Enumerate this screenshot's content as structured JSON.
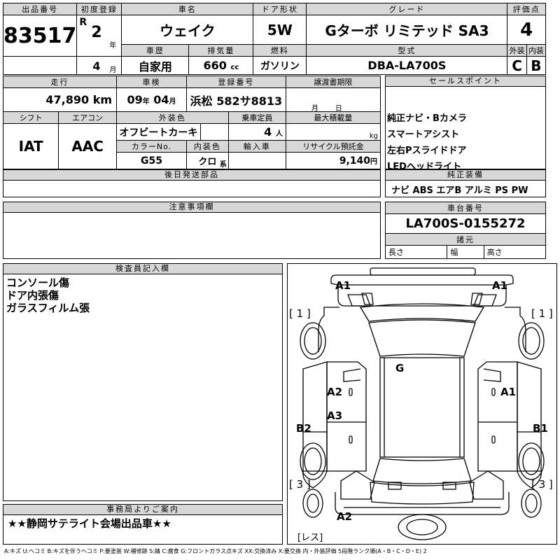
{
  "header": {
    "lot_label": "出品番号",
    "lot_no": "83517",
    "first_reg_label": "初度登録",
    "era": "R",
    "year": "2",
    "year_unit": "年",
    "month": "4",
    "month_unit": "月",
    "car_name_label": "車名",
    "car_name": "ウェイク",
    "door_label": "ドア形状",
    "door": "5W",
    "grade_label": "グレード",
    "grade": "Gターボ リミテッド SA3",
    "score_label": "評価点",
    "score": "4",
    "history_label": "車歴",
    "history": "自家用",
    "displacement_label": "排気量",
    "displacement": "660",
    "displacement_unit": "cc",
    "fuel_label": "燃料",
    "fuel": "ガソリン",
    "model_label": "型式",
    "model": "DBA-LA700S",
    "ext_label": "外装",
    "ext": "C",
    "int_label": "内装",
    "int": "B"
  },
  "row2": {
    "mileage_label": "走行",
    "mileage": "47,890",
    "mileage_unit": "km",
    "inspection_label": "車検",
    "insp_y": "09",
    "insp_y_unit": "年",
    "insp_m": "04",
    "insp_m_unit": "月",
    "plate_label": "登録番号",
    "plate": "浜松 582サ8813",
    "transfer_label": "譲渡書期限",
    "transfer_m_unit": "月",
    "transfer_d_unit": "日",
    "shift_label": "シフト",
    "shift": "IAT",
    "ac_label": "エアコン",
    "ac": "AAC",
    "color_label": "外装色",
    "color": "オフビートカーキ",
    "capacity_label": "乗車定員",
    "capacity": "4",
    "capacity_unit": "人",
    "load_label": "最大積載量",
    "load_unit": "kg",
    "color_no_label": "カラーNo.",
    "color_no": "G55",
    "interior_color_label": "内装色",
    "interior_color": "クロ",
    "interior_unit": "系",
    "import_label": "輸入車",
    "recycle_label": "リサイクル預託金",
    "recycle": "9,140",
    "recycle_unit": "円",
    "later_label": "後日発送部品"
  },
  "sales": {
    "label": "セールスポイント",
    "items": [
      "純正ナビ・Bカメラ",
      "スマートアシスト",
      "左右Pスライドドア",
      "LEDヘッドライト"
    ],
    "equip_label": "純正装備",
    "equip": "ナビ ABS エアB アルミ PS PW"
  },
  "notes": {
    "label": "注意事項欄"
  },
  "chassis": {
    "label": "車台番号",
    "value": "LA700S-0155272",
    "spec_label": "諸元",
    "length": "長さ",
    "width": "幅",
    "height": "高さ"
  },
  "inspector": {
    "label": "検査員記入欄",
    "lines": [
      "コンソール傷",
      "ドア内張傷",
      "ガラスフィルム張"
    ]
  },
  "office": {
    "label": "事務局よりご案内",
    "text": "★★静岡サテライト会場出品車★★"
  },
  "diagram": {
    "marks": {
      "a1_tl": "A1",
      "a1_tr": "A1",
      "br_l1": "[ 1 ]",
      "br_r1": "[ 1 ]",
      "g": "G",
      "a2_l": "A2",
      "a1_r": "A1",
      "a3_l": "A3",
      "b2_l": "B2",
      "b1_r": "B1",
      "br_l3": "[ 3 ]",
      "br_r3": "[ 3 ]",
      "a2_b": "A2",
      "res": "[レス]"
    }
  },
  "legend": "A:キズ U:ヘコミ B:キズを伴うヘコミ P:要塗装 W:補修跡 S:錆 C:腐食 G:フロントガラス点キズ XX:交換済み X:要交換 内・外装評価 5段階ランク順(A・B・C・D・E) 2"
}
